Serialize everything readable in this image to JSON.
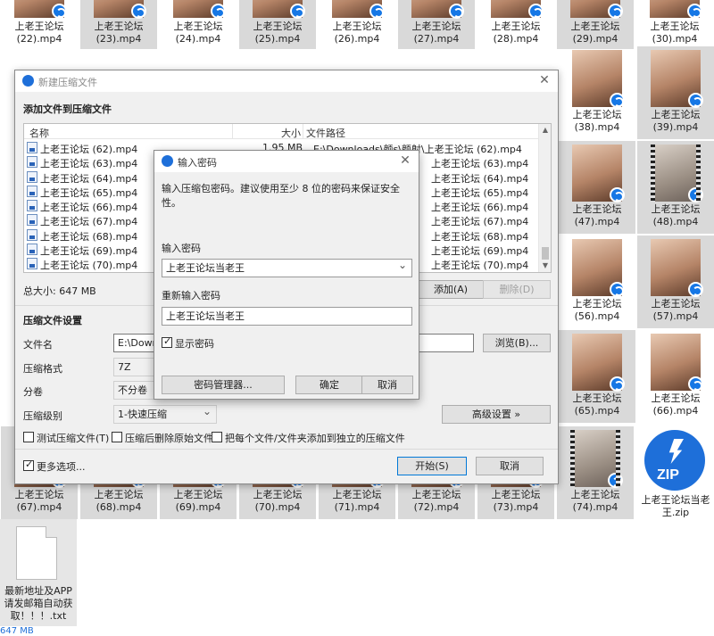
{
  "desktop": {
    "top_row": [
      {
        "label": "上老王论坛\n(22).mp4"
      },
      {
        "label": "上老王论坛\n(23).mp4"
      },
      {
        "label": "上老王论坛\n(24).mp4"
      },
      {
        "label": "上老王论坛\n(25).mp4"
      },
      {
        "label": "上老王论坛\n(26).mp4"
      },
      {
        "label": "上老王论坛\n(27).mp4"
      },
      {
        "label": "上老王论坛\n(28).mp4"
      },
      {
        "label": "上老王论坛\n(29).mp4"
      },
      {
        "label": "上老王论坛\n(30).mp4"
      }
    ],
    "right_col_a": [
      {
        "label": "上老王论坛\n(38).mp4"
      },
      {
        "label": "上老王论坛\n(47).mp4"
      },
      {
        "label": "上老王论坛\n(56).mp4"
      },
      {
        "label": "上老王论坛\n(65).mp4"
      }
    ],
    "right_col_b": [
      {
        "label": "上老王论坛\n(39).mp4"
      },
      {
        "label": "上老王论坛\n(48).mp4"
      },
      {
        "label": "上老王论坛\n(57).mp4"
      },
      {
        "label": "上老王论坛\n(66).mp4"
      }
    ],
    "bottom_row": [
      {
        "label": "上老王论坛\n(67).mp4"
      },
      {
        "label": "上老王论坛\n(68).mp4"
      },
      {
        "label": "上老王论坛\n(69).mp4"
      },
      {
        "label": "上老王论坛\n(70).mp4"
      },
      {
        "label": "上老王论坛\n(71).mp4"
      },
      {
        "label": "上老王论坛\n(72).mp4"
      },
      {
        "label": "上老王论坛\n(73).mp4"
      },
      {
        "label": "上老王论坛\n(74).mp4"
      }
    ],
    "zip_file": {
      "label": "上老王论坛当老\n王.zip",
      "badge": "ZIP"
    },
    "txt_file": {
      "label": "最新地址及APP\n请发邮箱自动获\n取！！！.txt"
    },
    "status_text": "647 MB",
    "icon_names": {
      "video": "video-thumbnail",
      "badge": "player-badge-icon",
      "zip": "zip-archive-icon",
      "txt": "text-document-icon"
    }
  },
  "archive_dialog": {
    "title": "新建压缩文件",
    "section_add": "添加文件到压缩文件",
    "columns": {
      "name": "名称",
      "size": "大小",
      "path": "文件路径"
    },
    "files": [
      {
        "name": "上老王论坛 (62).mp4",
        "size": "1.95 MB",
        "path": "E:\\Downloads\\颜s\\颜射\\上老王论坛 (62).mp4"
      },
      {
        "name": "上老王论坛 (63).mp4",
        "size": "",
        "path": "上老王论坛 (63).mp4"
      },
      {
        "name": "上老王论坛 (64).mp4",
        "size": "",
        "path": "上老王论坛 (64).mp4"
      },
      {
        "name": "上老王论坛 (65).mp4",
        "size": "",
        "path": "上老王论坛 (65).mp4"
      },
      {
        "name": "上老王论坛 (66).mp4",
        "size": "",
        "path": "上老王论坛 (66).mp4"
      },
      {
        "name": "上老王论坛 (67).mp4",
        "size": "",
        "path": "上老王论坛 (67).mp4"
      },
      {
        "name": "上老王论坛 (68).mp4",
        "size": "",
        "path": "上老王论坛 (68).mp4"
      },
      {
        "name": "上老王论坛 (69).mp4",
        "size": "",
        "path": "上老王论坛 (69).mp4"
      },
      {
        "name": "上老王论坛 (70).mp4",
        "size": "",
        "path": "上老王论坛 (70).mp4"
      }
    ],
    "total_size": "总大小: 647 MB",
    "add_button": "添加(A)",
    "delete_button": "删除(D)",
    "section_settings": "压缩文件设置",
    "filename_label": "文件名",
    "filename_value": "E:\\Downlo",
    "browse_button": "浏览(B)...",
    "format_label": "压缩格式",
    "format_value": "7Z",
    "split_label": "分卷",
    "split_value": "不分卷",
    "level_label": "压缩级别",
    "level_value": "1-快速压缩",
    "advanced_button": "高级设置 »",
    "opt_test": "测试压缩文件(T)",
    "opt_delete": "压缩后删除原始文件",
    "opt_each": "把每个文件/文件夹添加到独立的压缩文件",
    "more_options": "更多选项...",
    "start_button": "开始(S)",
    "cancel_button": "取消"
  },
  "password_dialog": {
    "title": "输入密码",
    "hint": "输入压缩包密码。建议使用至少 8 位的密码来保证安全性。",
    "enter_label": "输入密码",
    "password_value": "上老王论坛当老王",
    "reenter_label": "重新输入密码",
    "reenter_value": "上老王论坛当老王",
    "show_password": "显示密码",
    "show_password_checked": true,
    "manager_button": "密码管理器...",
    "ok_button": "确定",
    "cancel_button": "取消"
  }
}
